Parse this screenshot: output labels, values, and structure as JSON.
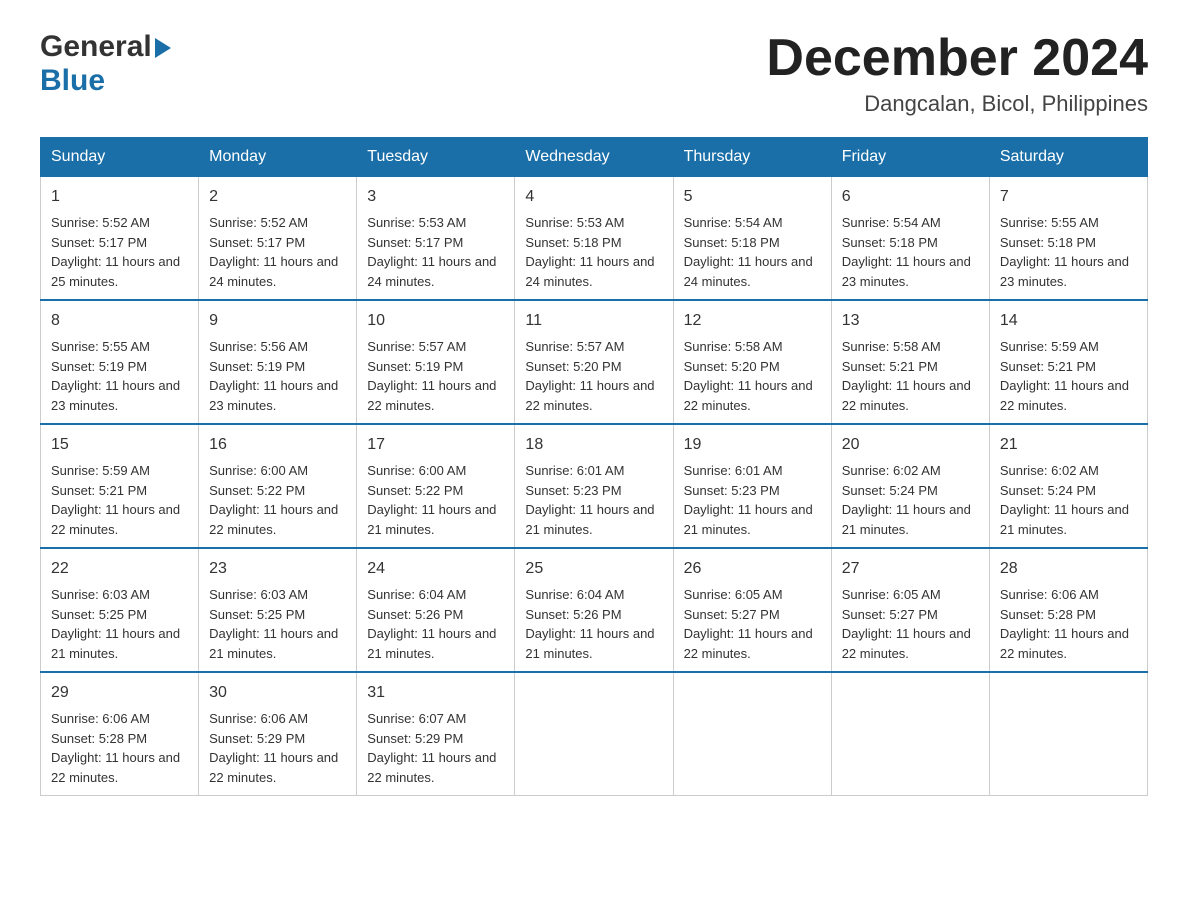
{
  "header": {
    "logo_general": "General",
    "logo_blue": "Blue",
    "month_title": "December 2024",
    "subtitle": "Dangcalan, Bicol, Philippines"
  },
  "days_of_week": [
    "Sunday",
    "Monday",
    "Tuesday",
    "Wednesday",
    "Thursday",
    "Friday",
    "Saturday"
  ],
  "weeks": [
    [
      {
        "day": "1",
        "sunrise": "5:52 AM",
        "sunset": "5:17 PM",
        "daylight": "11 hours and 25 minutes."
      },
      {
        "day": "2",
        "sunrise": "5:52 AM",
        "sunset": "5:17 PM",
        "daylight": "11 hours and 24 minutes."
      },
      {
        "day": "3",
        "sunrise": "5:53 AM",
        "sunset": "5:17 PM",
        "daylight": "11 hours and 24 minutes."
      },
      {
        "day": "4",
        "sunrise": "5:53 AM",
        "sunset": "5:18 PM",
        "daylight": "11 hours and 24 minutes."
      },
      {
        "day": "5",
        "sunrise": "5:54 AM",
        "sunset": "5:18 PM",
        "daylight": "11 hours and 24 minutes."
      },
      {
        "day": "6",
        "sunrise": "5:54 AM",
        "sunset": "5:18 PM",
        "daylight": "11 hours and 23 minutes."
      },
      {
        "day": "7",
        "sunrise": "5:55 AM",
        "sunset": "5:18 PM",
        "daylight": "11 hours and 23 minutes."
      }
    ],
    [
      {
        "day": "8",
        "sunrise": "5:55 AM",
        "sunset": "5:19 PM",
        "daylight": "11 hours and 23 minutes."
      },
      {
        "day": "9",
        "sunrise": "5:56 AM",
        "sunset": "5:19 PM",
        "daylight": "11 hours and 23 minutes."
      },
      {
        "day": "10",
        "sunrise": "5:57 AM",
        "sunset": "5:19 PM",
        "daylight": "11 hours and 22 minutes."
      },
      {
        "day": "11",
        "sunrise": "5:57 AM",
        "sunset": "5:20 PM",
        "daylight": "11 hours and 22 minutes."
      },
      {
        "day": "12",
        "sunrise": "5:58 AM",
        "sunset": "5:20 PM",
        "daylight": "11 hours and 22 minutes."
      },
      {
        "day": "13",
        "sunrise": "5:58 AM",
        "sunset": "5:21 PM",
        "daylight": "11 hours and 22 minutes."
      },
      {
        "day": "14",
        "sunrise": "5:59 AM",
        "sunset": "5:21 PM",
        "daylight": "11 hours and 22 minutes."
      }
    ],
    [
      {
        "day": "15",
        "sunrise": "5:59 AM",
        "sunset": "5:21 PM",
        "daylight": "11 hours and 22 minutes."
      },
      {
        "day": "16",
        "sunrise": "6:00 AM",
        "sunset": "5:22 PM",
        "daylight": "11 hours and 22 minutes."
      },
      {
        "day": "17",
        "sunrise": "6:00 AM",
        "sunset": "5:22 PM",
        "daylight": "11 hours and 21 minutes."
      },
      {
        "day": "18",
        "sunrise": "6:01 AM",
        "sunset": "5:23 PM",
        "daylight": "11 hours and 21 minutes."
      },
      {
        "day": "19",
        "sunrise": "6:01 AM",
        "sunset": "5:23 PM",
        "daylight": "11 hours and 21 minutes."
      },
      {
        "day": "20",
        "sunrise": "6:02 AM",
        "sunset": "5:24 PM",
        "daylight": "11 hours and 21 minutes."
      },
      {
        "day": "21",
        "sunrise": "6:02 AM",
        "sunset": "5:24 PM",
        "daylight": "11 hours and 21 minutes."
      }
    ],
    [
      {
        "day": "22",
        "sunrise": "6:03 AM",
        "sunset": "5:25 PM",
        "daylight": "11 hours and 21 minutes."
      },
      {
        "day": "23",
        "sunrise": "6:03 AM",
        "sunset": "5:25 PM",
        "daylight": "11 hours and 21 minutes."
      },
      {
        "day": "24",
        "sunrise": "6:04 AM",
        "sunset": "5:26 PM",
        "daylight": "11 hours and 21 minutes."
      },
      {
        "day": "25",
        "sunrise": "6:04 AM",
        "sunset": "5:26 PM",
        "daylight": "11 hours and 21 minutes."
      },
      {
        "day": "26",
        "sunrise": "6:05 AM",
        "sunset": "5:27 PM",
        "daylight": "11 hours and 22 minutes."
      },
      {
        "day": "27",
        "sunrise": "6:05 AM",
        "sunset": "5:27 PM",
        "daylight": "11 hours and 22 minutes."
      },
      {
        "day": "28",
        "sunrise": "6:06 AM",
        "sunset": "5:28 PM",
        "daylight": "11 hours and 22 minutes."
      }
    ],
    [
      {
        "day": "29",
        "sunrise": "6:06 AM",
        "sunset": "5:28 PM",
        "daylight": "11 hours and 22 minutes."
      },
      {
        "day": "30",
        "sunrise": "6:06 AM",
        "sunset": "5:29 PM",
        "daylight": "11 hours and 22 minutes."
      },
      {
        "day": "31",
        "sunrise": "6:07 AM",
        "sunset": "5:29 PM",
        "daylight": "11 hours and 22 minutes."
      },
      null,
      null,
      null,
      null
    ]
  ],
  "labels": {
    "sunrise": "Sunrise:",
    "sunset": "Sunset:",
    "daylight": "Daylight:"
  }
}
